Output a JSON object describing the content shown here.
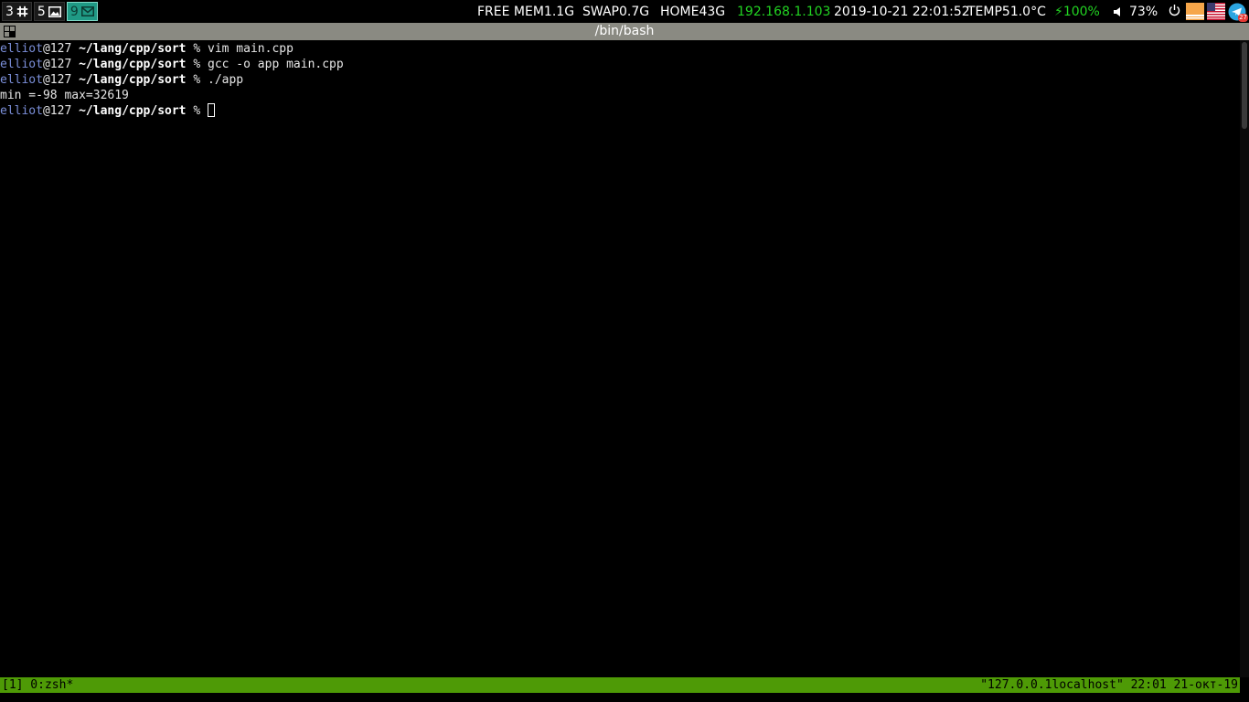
{
  "workspaces": [
    {
      "number": "3",
      "icon": "slack-icon",
      "active": false
    },
    {
      "number": "5",
      "icon": "image-icon",
      "active": false
    },
    {
      "number": "9",
      "icon": "mail-icon",
      "active": true
    }
  ],
  "status": {
    "mem": "FREE MEM1.1G",
    "swap": "SWAP0.7G",
    "home": "HOME43G",
    "ip": "192.168.1.103",
    "datetime": "2019-10-21 22:01:52",
    "temp": "TEMP51.0°C",
    "battery": "⚡100%",
    "volume": "73%"
  },
  "tray": {
    "power_icon": "power-icon",
    "keyboard_layout_icon": "us-flag-icon",
    "telegram_badge": "27"
  },
  "colors": {
    "accent_green": "#22d322",
    "tmux_bar": "#4e9a06",
    "titlebar": "#8a8a82"
  },
  "window": {
    "title": "/bin/bash"
  },
  "terminal": {
    "prompt_user": "elliot",
    "prompt_host": "@127",
    "prompt_path": " ~/lang/cpp/sort",
    "prompt_sign": " % ",
    "lines": [
      {
        "type": "prompt",
        "cmd": "vim main.cpp"
      },
      {
        "type": "prompt",
        "cmd": "gcc -o app main.cpp"
      },
      {
        "type": "prompt",
        "cmd": "./app"
      },
      {
        "type": "output",
        "text": "min =-98 max=32619"
      },
      {
        "type": "prompt",
        "cmd": "",
        "cursor": true
      }
    ]
  },
  "tmux": {
    "left": "[1] 0:zsh*",
    "right": "\"127.0.0.1localhost\" 22:01 21-окт-19"
  }
}
